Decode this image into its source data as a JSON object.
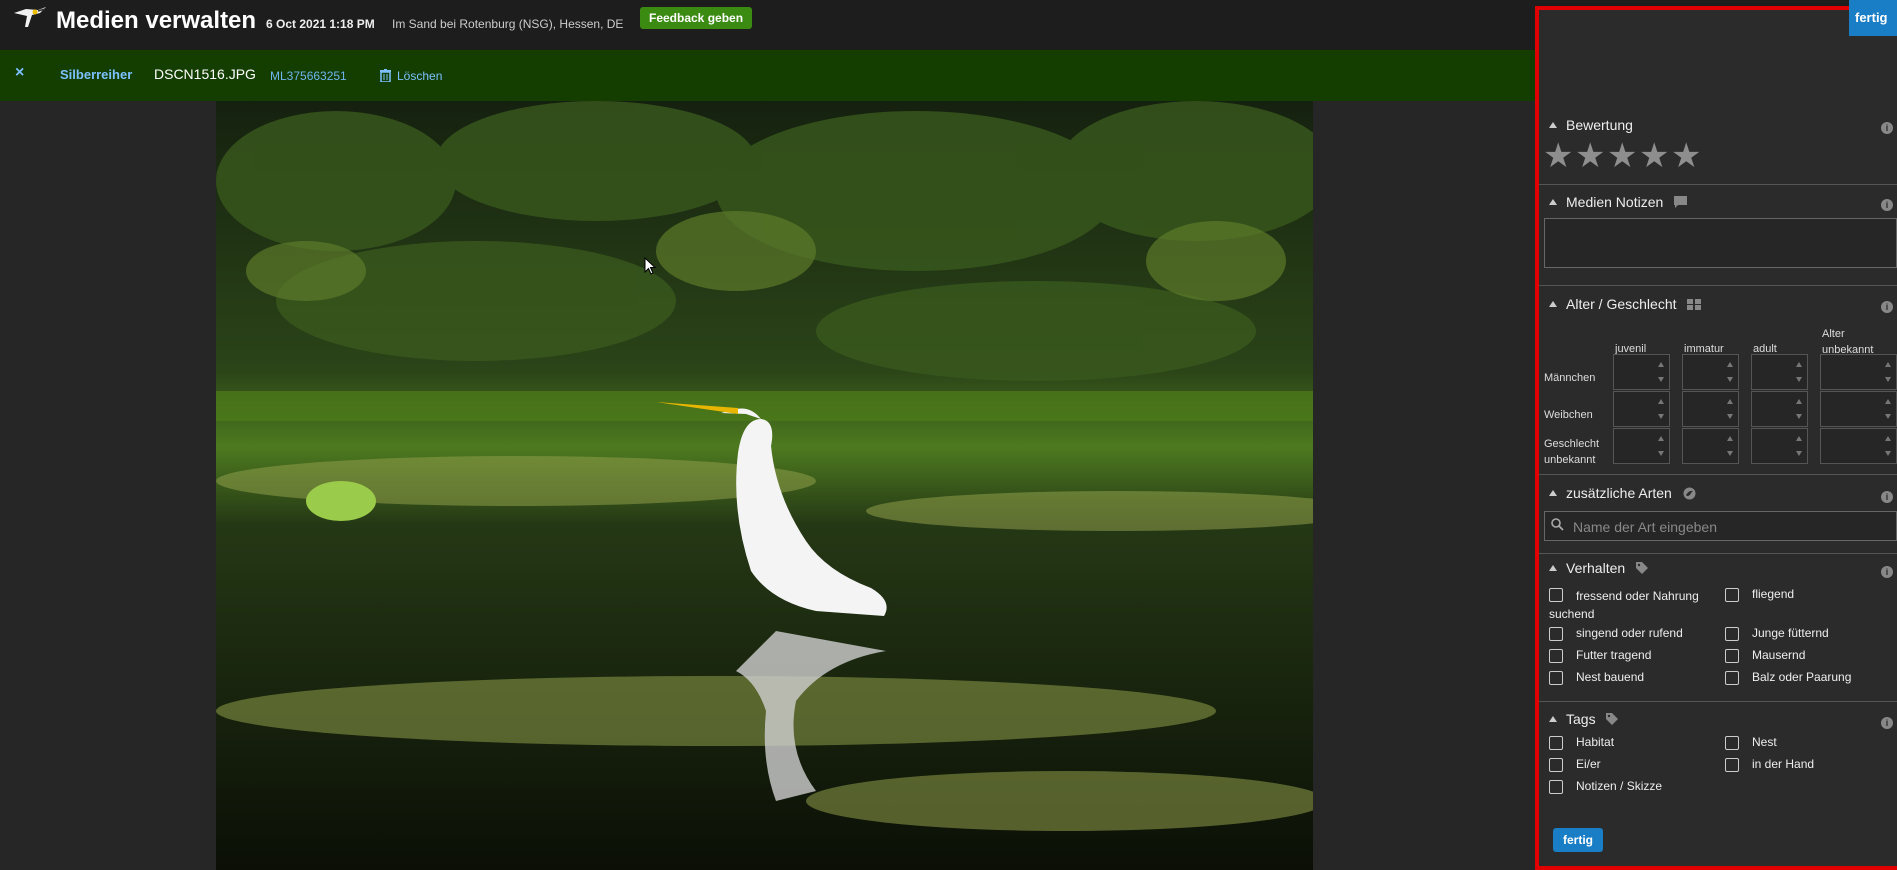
{
  "header": {
    "title": "Medien verwalten",
    "date": "6 Oct 2021 1:18 PM",
    "location": "Im Sand bei Rotenburg (NSG), Hessen, DE",
    "feedback_label": "Feedback geben"
  },
  "media_bar": {
    "close_icon": "×",
    "species": "Silberreiher",
    "filename": "DSCN1516.JPG",
    "catalog_id": "ML375663251",
    "delete_label": "Löschen",
    "prev_icon": "❮",
    "next_icon": "❯"
  },
  "panel": {
    "done_label": "fertig",
    "rating": {
      "title": "Bewertung",
      "stars": 5,
      "value": 0
    },
    "notes": {
      "title": "Medien Notizen",
      "value": ""
    },
    "age_sex": {
      "title": "Alter / Geschlecht",
      "columns": [
        "juvenil",
        "immatur",
        "adult",
        "Alter unbekannt"
      ],
      "rows": [
        "Männchen",
        "Weibchen",
        "Geschlecht unbekannt"
      ]
    },
    "additional_species": {
      "title": "zusätzliche Arten",
      "placeholder": "Name der Art eingeben"
    },
    "behavior": {
      "title": "Verhalten",
      "options": [
        "fressend oder Nahrung suchend",
        "fliegend",
        "singend oder rufend",
        "Junge fütternd",
        "Futter tragend",
        "Mausernd",
        "Nest bauend",
        "Balz oder Paarung"
      ]
    },
    "tags": {
      "title": "Tags",
      "options": [
        "Habitat",
        "Nest",
        "Ei/er",
        "in der Hand",
        "Notizen / Skizze"
      ]
    },
    "done_bottom_label": "fertig"
  },
  "colors": {
    "accent": "#1a7ec6",
    "feedback": "#3b8a12",
    "media_bar": "#133e00",
    "highlight_border": "#e00000"
  }
}
